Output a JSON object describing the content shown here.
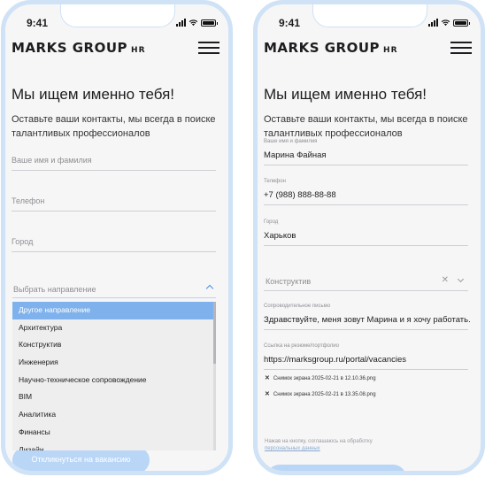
{
  "status": {
    "time": "9:41"
  },
  "header": {
    "brand": "MARKS GROUP",
    "brand_suffix": "HR"
  },
  "left": {
    "title": "Мы ищем именно тебя!",
    "subtitle": "Оставьте ваши контакты, мы всегда в поиске талантливых профессионалов",
    "fields": {
      "name_placeholder": "Ваше имя и фамилия",
      "phone_placeholder": "Телефон",
      "city_placeholder": "Город"
    },
    "direction_placeholder": "Выбрать направление",
    "options": [
      "Другое направление",
      "Архитектура",
      "Конструктив",
      "Инженерия",
      "Научно-техническое сопровождение",
      "BIM",
      "Аналитика",
      "Финансы",
      "Дизайн"
    ],
    "submit": "Откликнуться на вакансию"
  },
  "right": {
    "title": "Мы ищем именно тебя!",
    "subtitle": "Оставьте ваши контакты, мы всегда в поиске талантливых профессионалов",
    "name": {
      "label": "Ваше имя и фамилия",
      "value": "Марина Файная"
    },
    "phone": {
      "label": "Телефон",
      "value": "+7 (988) 888-88-88"
    },
    "city": {
      "label": "Город",
      "value": "Харьков"
    },
    "direction": {
      "value": "Конструктив"
    },
    "letter": {
      "label": "Сопроводительное письмо",
      "value": "Здравствуйте, меня зовут Марина и я хочу работать."
    },
    "resume": {
      "label": "Ссылка на резюме/портфолио",
      "value": "https://marksgroup.ru/portal/vacancies"
    },
    "files": [
      "Снимок экрана 2025-02-21 в 12.10.36.png",
      "Снимок экрана 2025-02-21 в 13.35.08.png"
    ],
    "consent_text": "Нажав на кнопку, соглашаюсь на обработку",
    "consent_link": "персональных данных"
  },
  "colors": {
    "accent": "#7fb2ec",
    "frame": "#cfe2f6",
    "button": "#b9d6f6"
  }
}
